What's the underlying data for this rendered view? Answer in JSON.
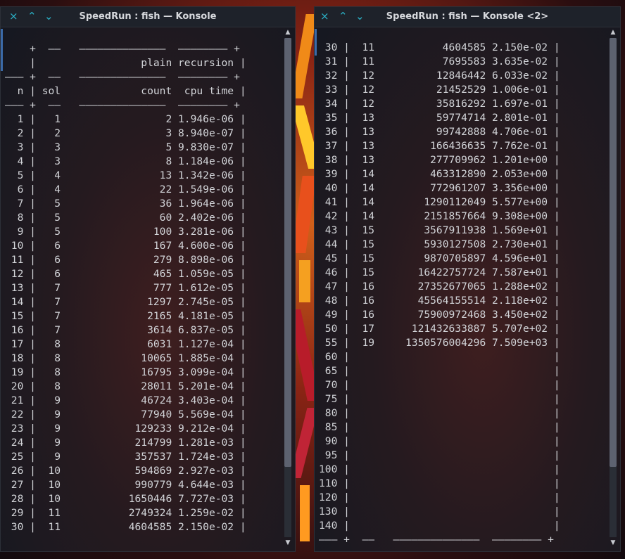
{
  "left_window": {
    "title": "SpeedRun : fish — Konsole",
    "lines": [
      "",
      "    +  ——   ——————————————  ———————— +",
      "    |                 plain recursion |",
      "——— +  ——   ——————————————  ———————— +",
      "  n | sol             count  cpu time |",
      "——— +  ——   ——————————————  ———————— +",
      "  1 |   1                 2 1.946e-06 |",
      "  2 |   2                 3 8.940e-07 |",
      "  3 |   3                 5 9.830e-07 |",
      "  4 |   3                 8 1.184e-06 |",
      "  5 |   4                13 1.342e-06 |",
      "  6 |   4                22 1.549e-06 |",
      "  7 |   5                36 1.964e-06 |",
      "  8 |   5                60 2.402e-06 |",
      "  9 |   5               100 3.281e-06 |",
      " 10 |   6               167 4.600e-06 |",
      " 11 |   6               279 8.898e-06 |",
      " 12 |   6               465 1.059e-05 |",
      " 13 |   7               777 1.612e-05 |",
      " 14 |   7              1297 2.745e-05 |",
      " 15 |   7              2165 4.181e-05 |",
      " 16 |   7              3614 6.837e-05 |",
      " 17 |   8              6031 1.127e-04 |",
      " 18 |   8             10065 1.885e-04 |",
      " 19 |   8             16795 3.099e-04 |",
      " 20 |   8             28011 5.201e-04 |",
      " 21 |   9             46724 3.403e-04 |",
      " 22 |   9             77940 5.569e-04 |",
      " 23 |   9            129233 9.212e-04 |",
      " 24 |   9            214799 1.281e-03 |",
      " 25 |   9            357537 1.724e-03 |",
      " 26 |  10            594869 2.927e-03 |",
      " 27 |  10            990779 4.644e-03 |",
      " 28 |  10           1650446 7.727e-03 |",
      " 29 |  11           2749324 1.259e-02 |",
      " 30 |  11           4604585 2.150e-02 |"
    ]
  },
  "right_window": {
    "title": "SpeedRun : fish — Konsole <2>",
    "lines": [
      " 30 |  11           4604585 2.150e-02 |",
      " 31 |  11           7695583 3.635e-02 |",
      " 32 |  12          12846442 6.033e-02 |",
      " 33 |  12          21452529 1.006e-01 |",
      " 34 |  12          35816292 1.697e-01 |",
      " 35 |  13          59774714 2.801e-01 |",
      " 36 |  13          99742888 4.706e-01 |",
      " 37 |  13         166436635 7.762e-01 |",
      " 38 |  13         277709962 1.201e+00 |",
      " 39 |  14         463312890 2.053e+00 |",
      " 40 |  14         772961207 3.356e+00 |",
      " 41 |  14        1290112049 5.577e+00 |",
      " 42 |  14        2151857664 9.308e+00 |",
      " 43 |  15        3567911938 1.569e+01 |",
      " 44 |  15        5930127508 2.730e+01 |",
      " 45 |  15        9870705897 4.596e+01 |",
      " 46 |  15       16422757724 7.587e+01 |",
      " 47 |  16       27352677065 1.288e+02 |",
      " 48 |  16       45564155514 2.118e+02 |",
      " 49 |  16       75900972468 3.450e+02 |",
      " 50 |  17      121432633887 5.707e+02 |",
      " 55 |  19     1350576004296 7.509e+03 |",
      " 60 |                                 |",
      " 65 |                                 |",
      " 70 |                                 |",
      " 75 |                                 |",
      " 80 |                                 |",
      " 85 |                                 |",
      " 90 |                                 |",
      " 95 |                                 |",
      "100 |                                 |",
      "110 |                                 |",
      "120 |                                 |",
      "130 |                                 |",
      "140 |                                 |",
      "——— +  ——   ——————————————  ———————— +"
    ]
  },
  "icons": {
    "close": "×",
    "up": "⌃",
    "down": "⌄",
    "scroll_up": "▲",
    "scroll_down": "▼"
  },
  "colors": {
    "accent": "#2bb3c9",
    "text": "#d2d4d8"
  }
}
